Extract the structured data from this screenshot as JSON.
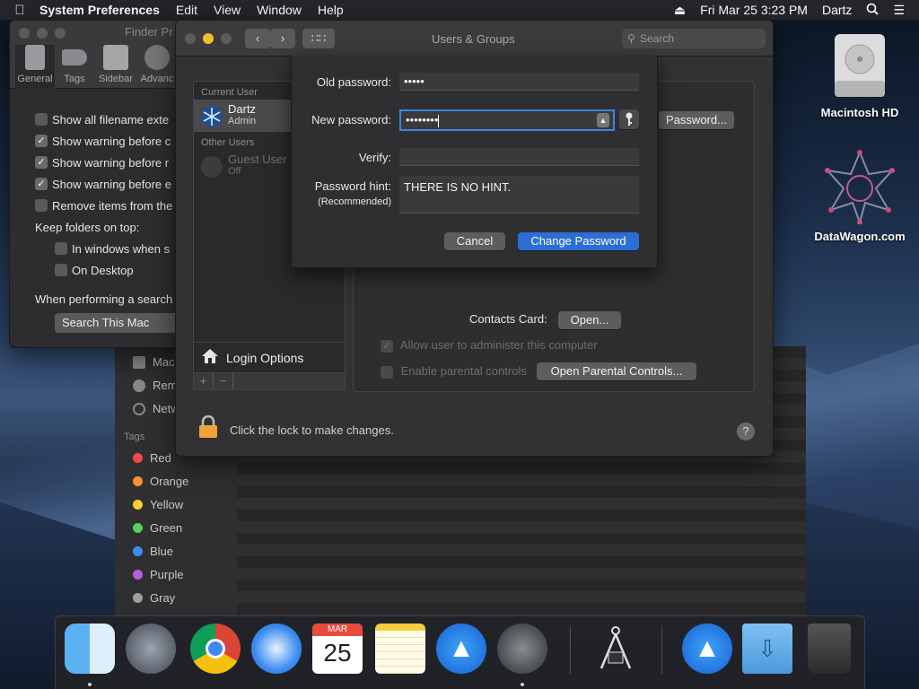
{
  "menubar": {
    "app_name": "System Preferences",
    "menus": [
      "Edit",
      "View",
      "Window",
      "Help"
    ],
    "datetime": "Fri Mar 25  3:23 PM",
    "user": "Dartz"
  },
  "finder_prefs": {
    "title": "Finder Pr",
    "tabs": [
      "General",
      "Tags",
      "Sidebar",
      "Advanc"
    ],
    "options": [
      {
        "label": "Show all filename exte",
        "checked": false
      },
      {
        "label": "Show warning before c",
        "checked": true
      },
      {
        "label": "Show warning before r",
        "checked": true
      },
      {
        "label": "Show warning before e",
        "checked": true
      },
      {
        "label": "Remove items from the",
        "checked": false
      }
    ],
    "keep_folders_label": "Keep folders on top:",
    "keep_options": [
      {
        "label": "In windows when s",
        "checked": false
      },
      {
        "label": "On Desktop",
        "checked": false
      }
    ],
    "search_label": "When performing a search",
    "search_scope": "Search This Mac"
  },
  "finder_sidebar": {
    "locations": [
      "Mac",
      "Rem",
      "Netw"
    ],
    "tags_header": "Tags",
    "tags": [
      {
        "name": "Red",
        "color": "#f5484c"
      },
      {
        "name": "Orange",
        "color": "#f7922e"
      },
      {
        "name": "Yellow",
        "color": "#f6cf2c"
      },
      {
        "name": "Green",
        "color": "#55d15a"
      },
      {
        "name": "Blue",
        "color": "#3a8ef2"
      },
      {
        "name": "Purple",
        "color": "#bb5ce0"
      },
      {
        "name": "Gray",
        "color": "#a0a0a3"
      }
    ]
  },
  "sysprefs": {
    "title": "Users & Groups",
    "search_placeholder": "Search",
    "current_user_header": "Current User",
    "current_user": {
      "name": "Dartz",
      "role": "Admin"
    },
    "other_users_header": "Other Users",
    "guest_user": {
      "name": "Guest User",
      "status": "Off"
    },
    "login_options": "Login Options",
    "change_password_btn": "Password...",
    "contacts_card_label": "Contacts Card:",
    "open_btn": "Open...",
    "allow_admin": "Allow user to administer this computer",
    "parental_controls": "Enable parental controls",
    "open_parental_btn": "Open Parental Controls...",
    "lock_text": "Click the lock to make changes.",
    "help": "?"
  },
  "sheet": {
    "old_password_label": "Old password:",
    "old_password_value": "•••••",
    "new_password_label": "New password:",
    "new_password_value": "••••••••",
    "verify_label": "Verify:",
    "verify_value": "",
    "hint_label": "Password hint:",
    "hint_sublabel": "(Recommended)",
    "hint_value": "THERE IS NO HINT.",
    "cancel": "Cancel",
    "change_password": "Change Password"
  },
  "desktop": {
    "icons": [
      "Macintosh HD",
      "DataWagon.com"
    ]
  },
  "dock": {
    "apps": [
      "Finder",
      "Launchpad",
      "Chrome",
      "Safari",
      "Calendar",
      "Notes",
      "App Store",
      "System Preferences",
      "Utility",
      "App Store",
      "Downloads",
      "Trash"
    ],
    "calendar_month": "MAR",
    "calendar_day": "25"
  }
}
